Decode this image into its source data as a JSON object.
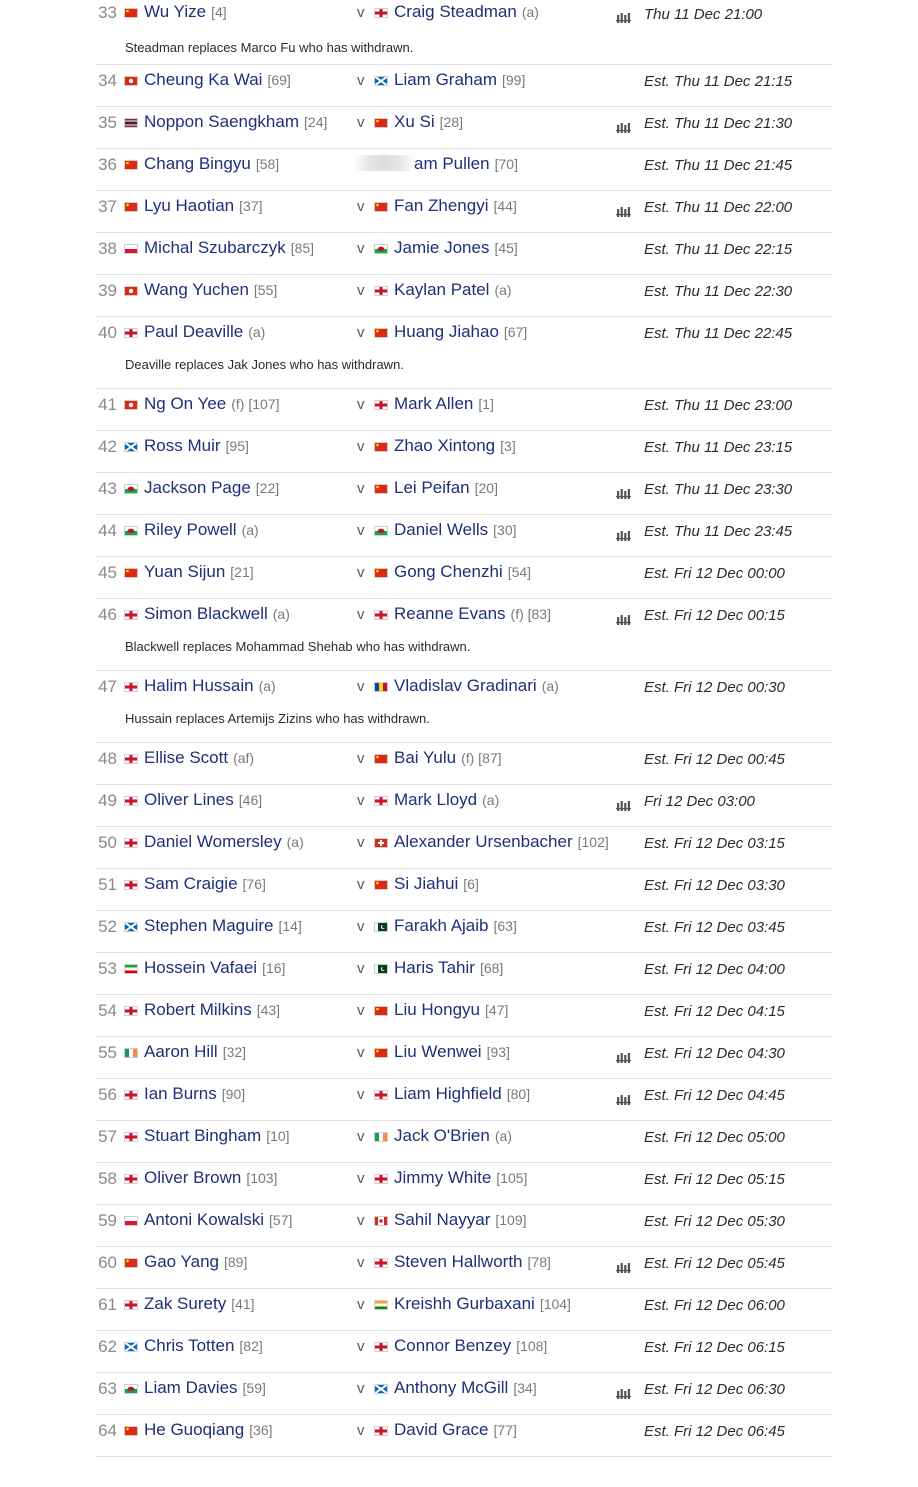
{
  "colors": {
    "name": "#1f2f7a",
    "seed": "#7a7a7a",
    "number": "#8a8a8a",
    "divider": "#e4e4e4"
  },
  "vs_label": "v",
  "matches": [
    {
      "num": "33",
      "p1": {
        "flag": "china",
        "name": "Wu Yize",
        "seed": "[4]"
      },
      "p2": {
        "flag": "england",
        "name": "Craig Steadman",
        "seed": "(a)"
      },
      "tv": true,
      "time": "Thu 11 Dec 21:00",
      "note": "Steadman replaces Marco Fu who has withdrawn."
    },
    {
      "num": "34",
      "p1": {
        "flag": "hongkong",
        "name": "Cheung Ka Wai",
        "seed": "[69]"
      },
      "p2": {
        "flag": "scotland",
        "name": "Liam Graham",
        "seed": "[99]"
      },
      "tv": false,
      "time": "Est. Thu 11 Dec 21:15"
    },
    {
      "num": "35",
      "p1": {
        "flag": "thailand",
        "name": "Noppon Saengkham",
        "seed": "[24]"
      },
      "p2": {
        "flag": "china",
        "name": "Xu Si",
        "seed": "[28]"
      },
      "tv": true,
      "time": "Est. Thu 11 Dec 21:30"
    },
    {
      "num": "36",
      "p1": {
        "flag": "china",
        "name": "Chang Bingyu",
        "seed": "[58]"
      },
      "p2": {
        "flag": "blurred",
        "name": "am Pullen",
        "seed": "[70]"
      },
      "tv": false,
      "time": "Est. Thu 11 Dec 21:45",
      "hide_vs": true
    },
    {
      "num": "37",
      "p1": {
        "flag": "china",
        "name": "Lyu Haotian",
        "seed": "[37]"
      },
      "p2": {
        "flag": "china",
        "name": "Fan Zhengyi",
        "seed": "[44]"
      },
      "tv": true,
      "time": "Est. Thu 11 Dec 22:00"
    },
    {
      "num": "38",
      "p1": {
        "flag": "poland",
        "name": "Michal Szubarczyk",
        "seed": "[85]"
      },
      "p2": {
        "flag": "wales",
        "name": "Jamie Jones",
        "seed": "[45]"
      },
      "tv": false,
      "time": "Est. Thu 11 Dec 22:15"
    },
    {
      "num": "39",
      "p1": {
        "flag": "hongkong",
        "name": "Wang Yuchen",
        "seed": "[55]"
      },
      "p2": {
        "flag": "england",
        "name": "Kaylan Patel",
        "seed": "(a)"
      },
      "tv": false,
      "time": "Est. Thu 11 Dec 22:30"
    },
    {
      "num": "40",
      "p1": {
        "flag": "england",
        "name": "Paul Deaville",
        "seed": "(a)"
      },
      "p2": {
        "flag": "china",
        "name": "Huang Jiahao",
        "seed": "[67]"
      },
      "tv": false,
      "time": "Est. Thu 11 Dec 22:45",
      "note": "Deaville replaces Jak Jones who has withdrawn."
    },
    {
      "num": "41",
      "p1": {
        "flag": "hongkong",
        "name": "Ng On Yee",
        "seed": "(f) [107]"
      },
      "p2": {
        "flag": "england",
        "name": "Mark Allen",
        "seed": "[1]"
      },
      "tv": false,
      "time": "Est. Thu 11 Dec 23:00"
    },
    {
      "num": "42",
      "p1": {
        "flag": "scotland",
        "name": "Ross Muir",
        "seed": "[95]"
      },
      "p2": {
        "flag": "china",
        "name": "Zhao Xintong",
        "seed": "[3]"
      },
      "tv": false,
      "time": "Est. Thu 11 Dec 23:15"
    },
    {
      "num": "43",
      "p1": {
        "flag": "wales",
        "name": "Jackson Page",
        "seed": "[22]"
      },
      "p2": {
        "flag": "china",
        "name": "Lei Peifan",
        "seed": "[20]"
      },
      "tv": true,
      "time": "Est. Thu 11 Dec 23:30"
    },
    {
      "num": "44",
      "p1": {
        "flag": "wales",
        "name": "Riley Powell",
        "seed": "(a)"
      },
      "p2": {
        "flag": "wales",
        "name": "Daniel Wells",
        "seed": "[30]"
      },
      "tv": true,
      "time": "Est. Thu 11 Dec 23:45"
    },
    {
      "num": "45",
      "p1": {
        "flag": "china",
        "name": "Yuan Sijun",
        "seed": "[21]"
      },
      "p2": {
        "flag": "china",
        "name": "Gong Chenzhi",
        "seed": "[54]"
      },
      "tv": false,
      "time": "Est. Fri 12 Dec 00:00"
    },
    {
      "num": "46",
      "p1": {
        "flag": "england",
        "name": "Simon Blackwell",
        "seed": "(a)"
      },
      "p2": {
        "flag": "england",
        "name": "Reanne Evans",
        "seed": "(f) [83]"
      },
      "tv": true,
      "time": "Est. Fri 12 Dec 00:15",
      "note": "Blackwell replaces Mohammad Shehab who has withdrawn."
    },
    {
      "num": "47",
      "p1": {
        "flag": "england",
        "name": "Halim Hussain",
        "seed": "(a)"
      },
      "p2": {
        "flag": "moldova",
        "name": "Vladislav Gradinari",
        "seed": "(a)"
      },
      "tv": false,
      "time": "Est. Fri 12 Dec 00:30",
      "note": "Hussain replaces Artemijs Zizins who has withdrawn."
    },
    {
      "num": "48",
      "p1": {
        "flag": "england",
        "name": "Ellise Scott",
        "seed": "(af)"
      },
      "p2": {
        "flag": "china",
        "name": "Bai Yulu",
        "seed": "(f) [87]"
      },
      "tv": false,
      "time": "Est. Fri 12 Dec 00:45"
    },
    {
      "num": "49",
      "p1": {
        "flag": "england",
        "name": "Oliver Lines",
        "seed": "[46]"
      },
      "p2": {
        "flag": "england",
        "name": "Mark Lloyd",
        "seed": "(a)"
      },
      "tv": true,
      "time": "Fri 12 Dec 03:00"
    },
    {
      "num": "50",
      "p1": {
        "flag": "england",
        "name": "Daniel Womersley",
        "seed": "(a)"
      },
      "p2": {
        "flag": "switzerland",
        "name": "Alexander Ursenbacher",
        "seed": "[102]"
      },
      "tv": false,
      "time": "Est. Fri 12 Dec 03:15"
    },
    {
      "num": "51",
      "p1": {
        "flag": "england",
        "name": "Sam Craigie",
        "seed": "[76]"
      },
      "p2": {
        "flag": "china",
        "name": "Si Jiahui",
        "seed": "[6]"
      },
      "tv": false,
      "time": "Est. Fri 12 Dec 03:30"
    },
    {
      "num": "52",
      "p1": {
        "flag": "scotland",
        "name": "Stephen Maguire",
        "seed": "[14]"
      },
      "p2": {
        "flag": "pakistan",
        "name": "Farakh Ajaib",
        "seed": "[63]"
      },
      "tv": false,
      "time": "Est. Fri 12 Dec 03:45"
    },
    {
      "num": "53",
      "p1": {
        "flag": "iran",
        "name": "Hossein Vafaei",
        "seed": "[16]"
      },
      "p2": {
        "flag": "pakistan",
        "name": "Haris Tahir",
        "seed": "[68]"
      },
      "tv": false,
      "time": "Est. Fri 12 Dec 04:00"
    },
    {
      "num": "54",
      "p1": {
        "flag": "england",
        "name": "Robert Milkins",
        "seed": "[43]"
      },
      "p2": {
        "flag": "china",
        "name": "Liu Hongyu",
        "seed": "[47]"
      },
      "tv": false,
      "time": "Est. Fri 12 Dec 04:15"
    },
    {
      "num": "55",
      "p1": {
        "flag": "ireland",
        "name": "Aaron Hill",
        "seed": "[32]"
      },
      "p2": {
        "flag": "china",
        "name": "Liu Wenwei",
        "seed": "[93]"
      },
      "tv": true,
      "time": "Est. Fri 12 Dec 04:30"
    },
    {
      "num": "56",
      "p1": {
        "flag": "england",
        "name": "Ian Burns",
        "seed": "[90]"
      },
      "p2": {
        "flag": "england",
        "name": "Liam Highfield",
        "seed": "[80]"
      },
      "tv": true,
      "time": "Est. Fri 12 Dec 04:45"
    },
    {
      "num": "57",
      "p1": {
        "flag": "england",
        "name": "Stuart Bingham",
        "seed": "[10]"
      },
      "p2": {
        "flag": "ireland",
        "name": "Jack O'Brien",
        "seed": "(a)"
      },
      "tv": false,
      "time": "Est. Fri 12 Dec 05:00"
    },
    {
      "num": "58",
      "p1": {
        "flag": "england",
        "name": "Oliver Brown",
        "seed": "[103]"
      },
      "p2": {
        "flag": "england",
        "name": "Jimmy White",
        "seed": "[105]"
      },
      "tv": false,
      "time": "Est. Fri 12 Dec 05:15"
    },
    {
      "num": "59",
      "p1": {
        "flag": "poland",
        "name": "Antoni Kowalski",
        "seed": "[57]"
      },
      "p2": {
        "flag": "canada",
        "name": "Sahil Nayyar",
        "seed": "[109]"
      },
      "tv": false,
      "time": "Est. Fri 12 Dec 05:30"
    },
    {
      "num": "60",
      "p1": {
        "flag": "china",
        "name": "Gao Yang",
        "seed": "[89]"
      },
      "p2": {
        "flag": "england",
        "name": "Steven Hallworth",
        "seed": "[78]"
      },
      "tv": true,
      "time": "Est. Fri 12 Dec 05:45"
    },
    {
      "num": "61",
      "p1": {
        "flag": "england",
        "name": "Zak Surety",
        "seed": "[41]"
      },
      "p2": {
        "flag": "india",
        "name": "Kreishh Gurbaxani",
        "seed": "[104]"
      },
      "tv": false,
      "time": "Est. Fri 12 Dec 06:00"
    },
    {
      "num": "62",
      "p1": {
        "flag": "scotland",
        "name": "Chris Totten",
        "seed": "[82]"
      },
      "p2": {
        "flag": "england",
        "name": "Connor Benzey",
        "seed": "[108]"
      },
      "tv": false,
      "time": "Est. Fri 12 Dec 06:15"
    },
    {
      "num": "63",
      "p1": {
        "flag": "wales",
        "name": "Liam Davies",
        "seed": "[59]"
      },
      "p2": {
        "flag": "scotland",
        "name": "Anthony McGill",
        "seed": "[34]"
      },
      "tv": true,
      "time": "Est. Fri 12 Dec 06:30"
    },
    {
      "num": "64",
      "p1": {
        "flag": "china",
        "name": "He Guoqiang",
        "seed": "[36]"
      },
      "p2": {
        "flag": "england",
        "name": "David Grace",
        "seed": "[77]"
      },
      "tv": false,
      "time": "Est. Fri 12 Dec 06:45"
    }
  ]
}
